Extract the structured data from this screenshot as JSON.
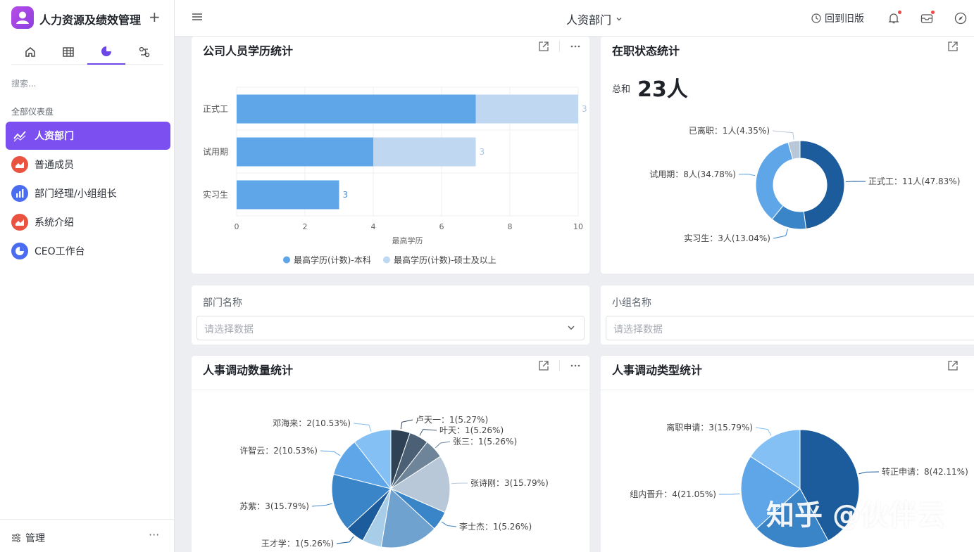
{
  "app": {
    "title": "人力资源及绩效管理",
    "add_label": "+"
  },
  "nav": {
    "tabs": [
      "home-icon",
      "table-icon",
      "dashboard-icon",
      "workflow-icon"
    ],
    "active": 2
  },
  "sidebar": {
    "search_placeholder": "搜索...",
    "section_label": "全部仪表盘",
    "items": [
      {
        "label": "人资部门",
        "icon": "line-chart-icon",
        "color": "#7b4ff0",
        "active": true
      },
      {
        "label": "普通成员",
        "icon": "area-chart-icon",
        "color": "#e9533f"
      },
      {
        "label": "部门经理/小组组长",
        "icon": "bar-chart-icon",
        "color": "#4a6cf0"
      },
      {
        "label": "系统介绍",
        "icon": "area-chart-icon",
        "color": "#e9533f"
      },
      {
        "label": "CEO工作台",
        "icon": "pie-chart-icon",
        "color": "#4a6cf0"
      }
    ],
    "footer": {
      "manage_label": "管理",
      "more_label": "···"
    }
  },
  "topbar": {
    "page_title": "人资部门",
    "back_old_label": "回到旧版"
  },
  "cards": {
    "education": {
      "title": "公司人员学历统计"
    },
    "status": {
      "title": "在职状态统计",
      "total_label": "总和",
      "total_value": "23人"
    },
    "dept_filter": {
      "label": "部门名称",
      "placeholder": "请选择数据"
    },
    "group_filter": {
      "label": "小组名称",
      "placeholder": "请选择数据"
    },
    "transfer_count": {
      "title": "人事调动数量统计"
    },
    "transfer_type": {
      "title": "人事调动类型统计"
    }
  },
  "watermark": "知乎 @伙伴云",
  "colors": {
    "accent": "#7b4ff0",
    "bar_primary": "#5ea6e8",
    "bar_secondary": "#c0d7f2",
    "dark_blue": "#1c5c9c"
  },
  "chart_data": [
    {
      "type": "bar",
      "orientation": "horizontal",
      "stacked": true,
      "categories": [
        "正式工",
        "试用期",
        "实习生"
      ],
      "series": [
        {
          "name": "最高学历(计数)-本科",
          "values": [
            7,
            4,
            3
          ],
          "color": "#5ea6e8"
        },
        {
          "name": "最高学历(计数)-硕士及以上",
          "values": [
            3,
            3,
            0
          ],
          "color": "#c0d7f2"
        }
      ],
      "xlabel": "最高学历",
      "xlim": [
        0,
        10
      ],
      "xticks": [
        "0",
        "2",
        "4",
        "6",
        "8",
        "10"
      ],
      "grid": true,
      "legend": "bottom"
    },
    {
      "type": "pie",
      "donut": true,
      "slices": [
        {
          "label": "正式工：11人(47.83%)",
          "value": 11,
          "color": "#1c5c9c"
        },
        {
          "label": "实习生：3人(13.04%)",
          "value": 3,
          "color": "#3a84c8"
        },
        {
          "label": "试用期：8人(34.78%)",
          "value": 8,
          "color": "#5ea6e8"
        },
        {
          "label": "已离职：1人(4.35%)",
          "value": 1,
          "color": "#b8c8d8"
        }
      ]
    },
    {
      "type": "pie",
      "slices": [
        {
          "label": "卢天一：1(5.27%)",
          "value": 1,
          "color": "#2e4155"
        },
        {
          "label": "叶天：1(5.26%)",
          "value": 1,
          "color": "#4b6075"
        },
        {
          "label": "张三：1(5.26%)",
          "value": 1,
          "color": "#6e8499"
        },
        {
          "label": "张诗刚：3(15.79%)",
          "value": 3,
          "color": "#b8c8d8"
        },
        {
          "label": "李士杰：1(5.26%)",
          "value": 1,
          "color": "#3a84c8"
        },
        {
          "label": "",
          "value": 3,
          "color": "#6fa2cf"
        },
        {
          "label": "",
          "value": 1,
          "color": "#a8cde9"
        },
        {
          "label": "王才学：1(5.26%)",
          "value": 1,
          "color": "#1c5c9c"
        },
        {
          "label": "苏紫：3(15.79%)",
          "value": 3,
          "color": "#3a84c8"
        },
        {
          "label": "许智云：2(10.53%)",
          "value": 2,
          "color": "#5ea6e8"
        },
        {
          "label": "邓海来：2(10.53%)",
          "value": 2,
          "color": "#85c0f5"
        }
      ]
    },
    {
      "type": "pie",
      "slices": [
        {
          "label": "转正申请：8(42.11%)",
          "value": 8,
          "color": "#1c5c9c"
        },
        {
          "label": "",
          "value": 4,
          "color": "#3a84c8"
        },
        {
          "label": "组内晋升：4(21.05%)",
          "value": 4,
          "color": "#5ea6e8"
        },
        {
          "label": "离职申请：3(15.79%)",
          "value": 3,
          "color": "#85c0f5"
        }
      ]
    }
  ]
}
